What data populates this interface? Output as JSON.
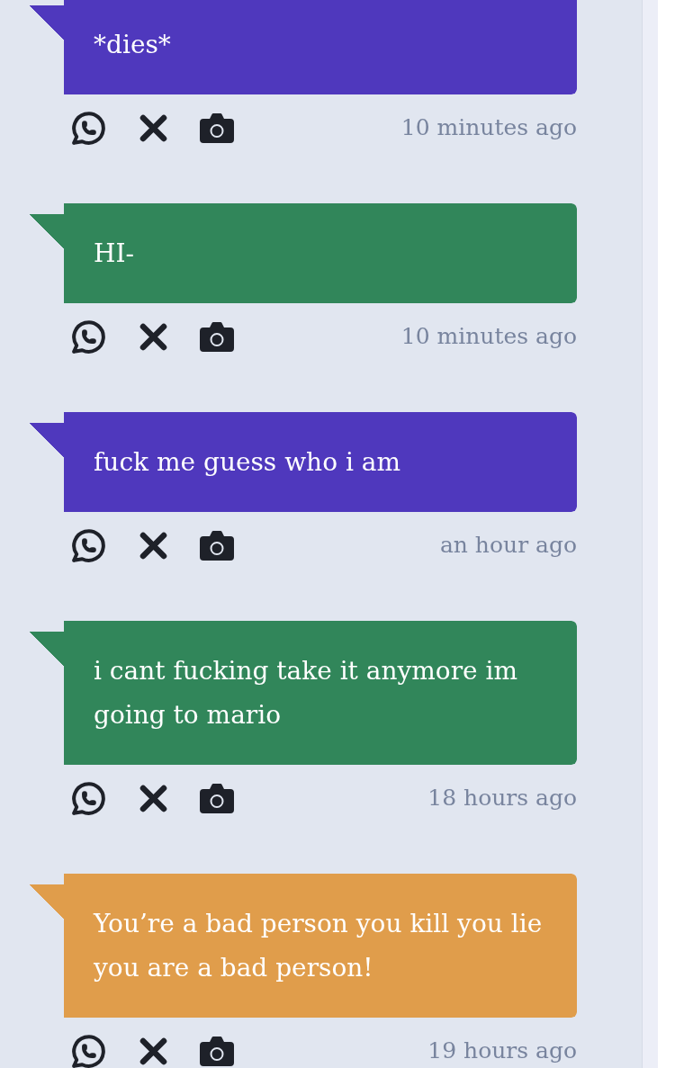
{
  "messages": [
    {
      "text": "*dies*",
      "color": "#4f38bd",
      "time": "10 minutes ago"
    },
    {
      "text": "HI-",
      "color": "#31865a",
      "time": "10 minutes ago"
    },
    {
      "text": "fuck me guess who i am",
      "color": "#4f38bd",
      "time": "an hour ago"
    },
    {
      "text": "i cant fucking take it anymore im going to mario",
      "color": "#31865a",
      "time": "18 hours ago"
    },
    {
      "text": "You’re a bad person you kill you lie you are a bad person!",
      "color": "#e09d4b",
      "time": "19 hours ago"
    }
  ]
}
